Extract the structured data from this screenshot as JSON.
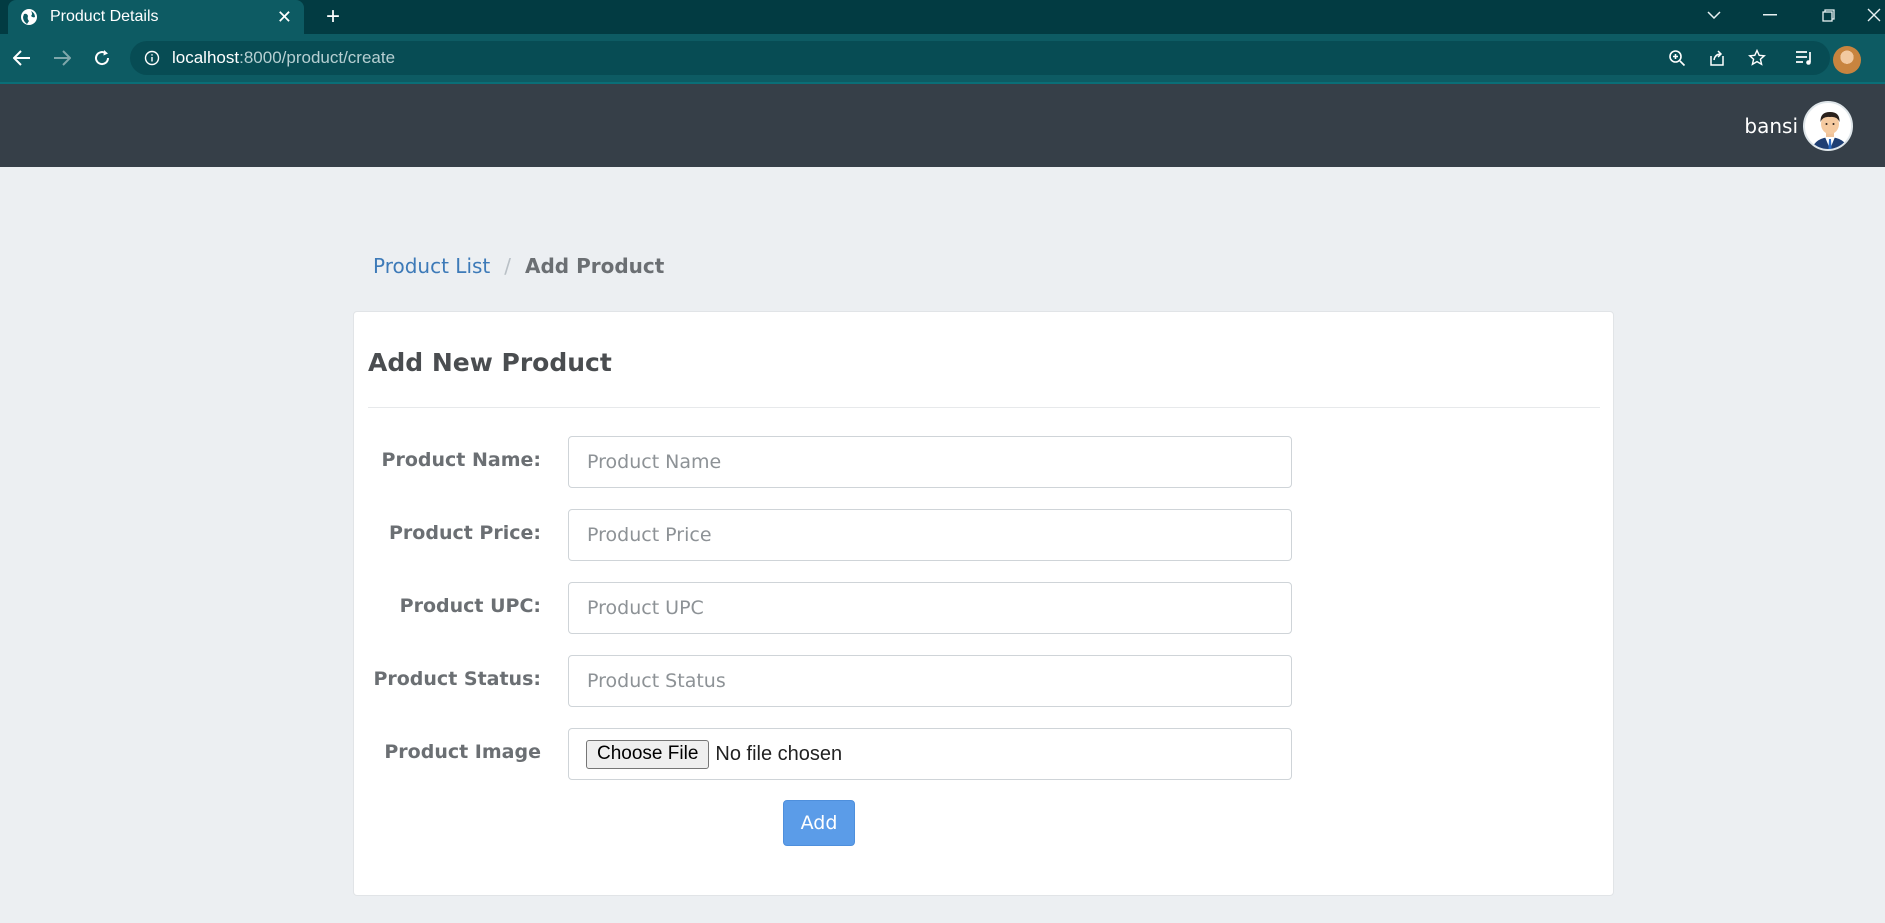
{
  "browser": {
    "tab_title": "Product Details",
    "url_host": "localhost",
    "url_rest": ":8000/product/create"
  },
  "header": {
    "username": "bansi"
  },
  "breadcrumb": {
    "link": "Product List",
    "separator": "/",
    "current": "Add Product"
  },
  "form": {
    "title": "Add New Product",
    "fields": [
      {
        "label": "Product Name:",
        "placeholder": "Product Name",
        "value": ""
      },
      {
        "label": "Product Price:",
        "placeholder": "Product Price",
        "value": ""
      },
      {
        "label": "Product UPC:",
        "placeholder": "Product UPC",
        "value": ""
      },
      {
        "label": "Product Status:",
        "placeholder": "Product Status",
        "value": ""
      }
    ],
    "image": {
      "label": "Product Image",
      "button": "Choose File",
      "status": "No file chosen"
    },
    "submit": "Add"
  },
  "colors": {
    "appbar": "#363f48",
    "accent": "#5b9ce8",
    "link": "#3d7ab8"
  }
}
